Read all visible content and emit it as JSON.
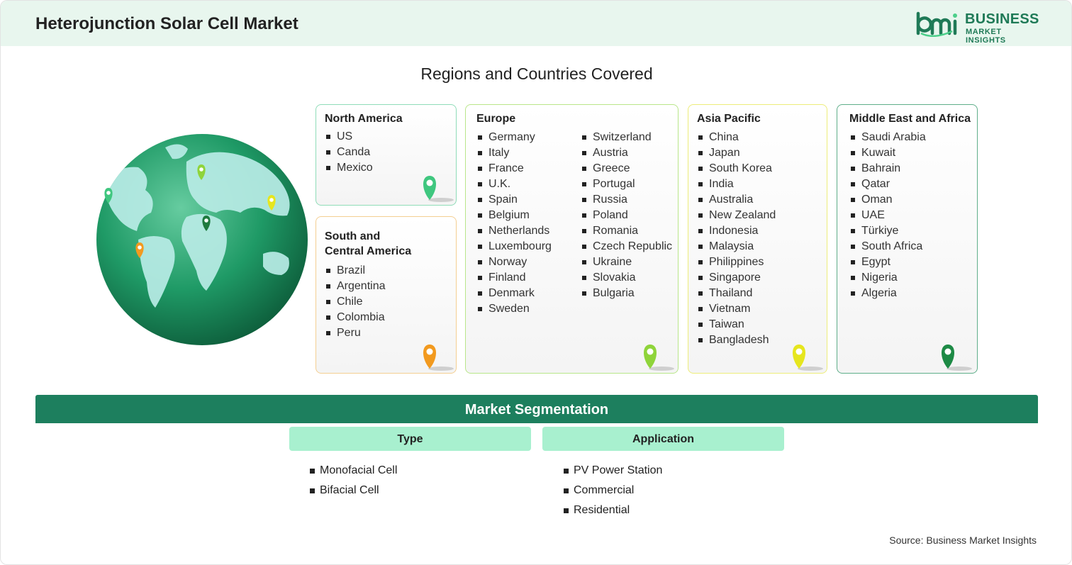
{
  "header": {
    "title": "Heterojunction Solar Cell Market"
  },
  "logo": {
    "line1": "BUSINESS",
    "line2": "MARKET INSIGHTS",
    "brand_color": "#1f7a57"
  },
  "regions_title": "Regions and Countries Covered",
  "regions": {
    "north_america": {
      "name": "North America",
      "countries": [
        "US",
        "Canda",
        "Mexico"
      ],
      "pin_color": "#3fc77f"
    },
    "south_central_america": {
      "name_line1": "South and",
      "name_line2": "Central America",
      "countries": [
        "Brazil",
        "Argentina",
        "Chile",
        "Colombia",
        "Peru"
      ],
      "pin_color": "#f29a1f"
    },
    "europe": {
      "name": "Europe",
      "countries_col1": [
        "Germany",
        "Italy",
        "France",
        "U.K.",
        "Spain",
        "Belgium",
        "Netherlands",
        "Luxembourg",
        "Norway",
        "Finland",
        "Denmark",
        "Sweden"
      ],
      "countries_col2": [
        "Switzerland",
        "Austria",
        "Greece",
        "Portugal",
        "Russia",
        "Poland",
        "Romania",
        "Czech Republic",
        "Ukraine",
        "Slovakia",
        "Bulgaria"
      ],
      "pin_color": "#8fd43a"
    },
    "asia_pacific": {
      "name": "Asia Pacific",
      "countries": [
        "China",
        "Japan",
        "South Korea",
        "India",
        "Australia",
        "New Zealand",
        "Indonesia",
        "Malaysia",
        "Philippines",
        "Singapore",
        "Thailand",
        "Vietnam",
        "Taiwan",
        "Bangladesh"
      ],
      "pin_color": "#e6e61e"
    },
    "middle_east_africa": {
      "name": "Middle East and Africa",
      "countries": [
        "Saudi Arabia",
        "Kuwait",
        "Bahrain",
        "Qatar",
        "Oman",
        "UAE",
        "Türkiye",
        "South Africa",
        "Egypt",
        "Nigeria",
        "Algeria"
      ],
      "pin_color": "#1d8a45"
    }
  },
  "segmentation": {
    "title": "Market Segmentation",
    "type": {
      "label": "Type",
      "items": [
        "Monofacial Cell",
        "Bifacial Cell"
      ]
    },
    "application": {
      "label": "Application",
      "items": [
        "PV Power Station",
        "Commercial",
        "Residential"
      ]
    }
  },
  "source": "Source: Business Market Insights",
  "icons": [
    "bmi-logo-icon",
    "globe-icon",
    "location-pin-icon"
  ]
}
